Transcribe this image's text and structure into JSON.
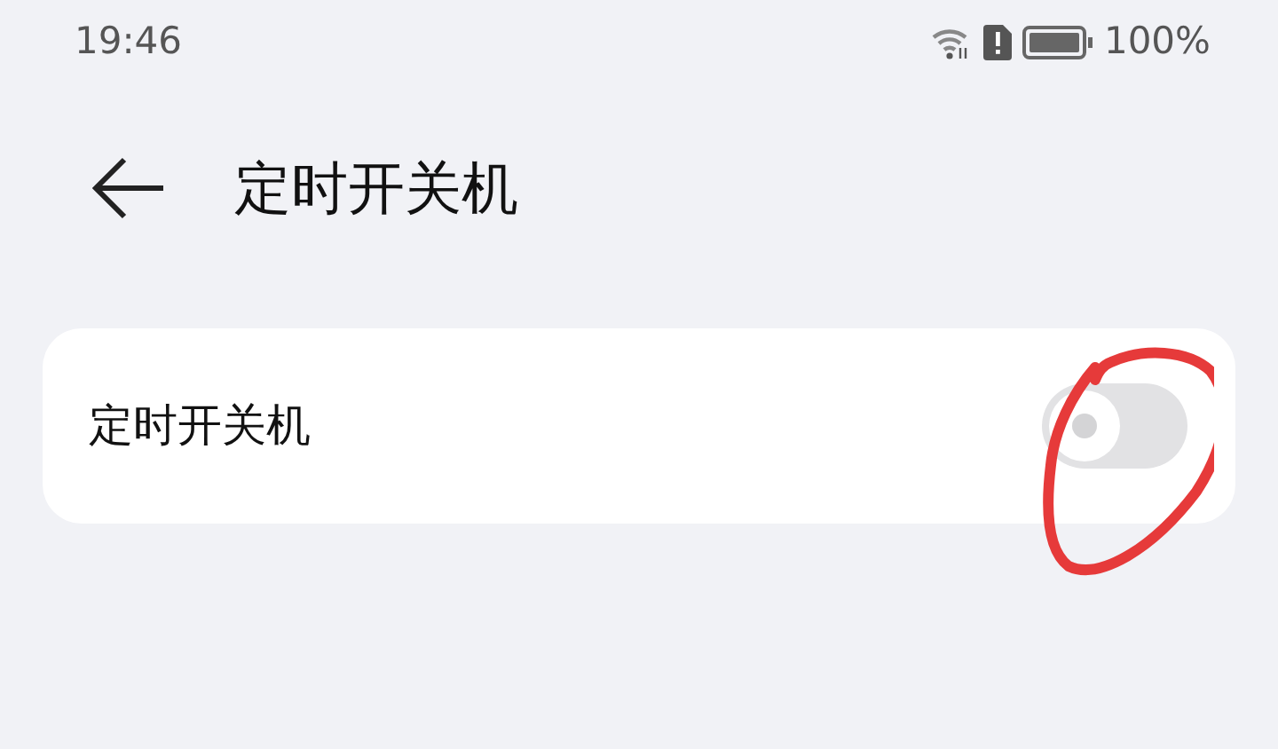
{
  "status_bar": {
    "time": "19:46",
    "battery": "100%"
  },
  "header": {
    "title": "定时开关机"
  },
  "settings": [
    {
      "label": "定时开关机",
      "kind": "switch",
      "on": false
    }
  ]
}
